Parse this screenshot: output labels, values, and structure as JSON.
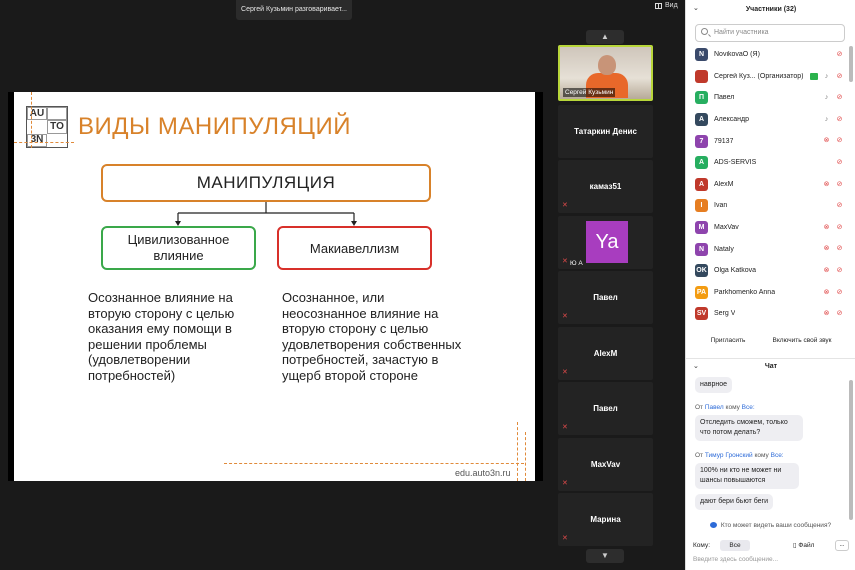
{
  "top": {
    "speaker_banner": "Сергей Кузьмин разговаривает...",
    "view_label": "Вид"
  },
  "slide": {
    "logo_cells": [
      "AU",
      "TO",
      "3N",
      ""
    ],
    "title": "ВИДЫ МАНИПУЛЯЦИЙ",
    "main_box": "МАНИПУЛЯЦИЯ",
    "left_box": "Цивилизованное влияние",
    "right_box": "Макиавеллизм",
    "left_text": "Осознанное влияние на вторую сторону с целью оказания ему помощи в решении проблемы (удовлетворении потребностей)",
    "right_text": "Осознанное, или неосознанное влияние на вторую сторону с целью удовлетворения собственных потребностей, зачастую в ущерб второй стороне",
    "footer": "edu.auto3n.ru",
    "accent": "#d8822a"
  },
  "gallery": {
    "video_tile_label": "Сергей Кузьмин",
    "tiles": [
      {
        "name": "Татаркин Денис"
      },
      {
        "name": "камаз51"
      },
      {
        "name": "Ю А",
        "avatar": "Ya",
        "avatar_color": "#a83dbf"
      },
      {
        "name": "Павел"
      },
      {
        "name": "AlexM"
      },
      {
        "name": "Павел"
      },
      {
        "name": "MaxVav"
      },
      {
        "name": "Марина"
      }
    ]
  },
  "panel": {
    "participants_title": "Участники (32)",
    "search_placeholder": "Найти участника",
    "participants": [
      {
        "initial": "N",
        "color": "#3a4a6b",
        "name": "NovikovaO (Я)",
        "icons": [
          "cam-off"
        ]
      },
      {
        "initial": "",
        "color": "#c0392b",
        "name": "Сергей Куз...  (Организатор)",
        "icons": [
          "share",
          "mic-on",
          "cam-off"
        ]
      },
      {
        "initial": "П",
        "color": "#27ae60",
        "name": "Павел",
        "icons": [
          "mic-on",
          "cam-off"
        ]
      },
      {
        "initial": "А",
        "color": "#34495e",
        "name": "Александр",
        "icons": [
          "mic-on",
          "cam-off"
        ]
      },
      {
        "initial": "7",
        "color": "#8e44ad",
        "name": "79137",
        "icons": [
          "mic-off",
          "cam-off"
        ]
      },
      {
        "initial": "A",
        "color": "#27ae60",
        "name": "ADS-SERVIS",
        "icons": [
          "cam-off"
        ]
      },
      {
        "initial": "A",
        "color": "#c0392b",
        "name": "AlexM",
        "icons": [
          "mic-off",
          "cam-off"
        ]
      },
      {
        "initial": "I",
        "color": "#e67e22",
        "name": "Ivan",
        "icons": [
          "cam-off"
        ]
      },
      {
        "initial": "M",
        "color": "#8e44ad",
        "name": "MaxVav",
        "icons": [
          "mic-off",
          "cam-off"
        ]
      },
      {
        "initial": "N",
        "color": "#8e44ad",
        "name": "Nataly",
        "icons": [
          "mic-off",
          "cam-off"
        ]
      },
      {
        "initial": "OK",
        "color": "#34495e",
        "name": "Olga Katkova",
        "icons": [
          "mic-off",
          "cam-off"
        ]
      },
      {
        "initial": "PA",
        "color": "#f39c12",
        "name": "Parkhomenko Anna",
        "icons": [
          "mic-off",
          "cam-off"
        ]
      },
      {
        "initial": "SV",
        "color": "#c0392b",
        "name": "Serg V",
        "icons": [
          "mic-off",
          "cam-off"
        ]
      }
    ],
    "invite_label": "Пригласить",
    "unmute_label": "Включить свой звук",
    "chat_title": "Чат",
    "messages": {
      "m1": "наврное",
      "from2_prefix": "От",
      "from2_name": "Павел",
      "from2_mid": "кому",
      "from2_to": "Все:",
      "m2": "Отследить сможем, только что потом делать?",
      "from3_prefix": "От",
      "from3_name": "Тимур Гронский",
      "from3_mid": "кому",
      "from3_to": "Все:",
      "m3": "100% ни кто не может ни шансы повышаются",
      "m4": "дают бери бьют беги"
    },
    "who_sees": "Кто может видеть ваши сообщения?",
    "to_label": "Кому:",
    "to_value": "Все",
    "file_label": "Файл",
    "more_label": "...",
    "input_placeholder": "Введите здесь сообщение..."
  }
}
